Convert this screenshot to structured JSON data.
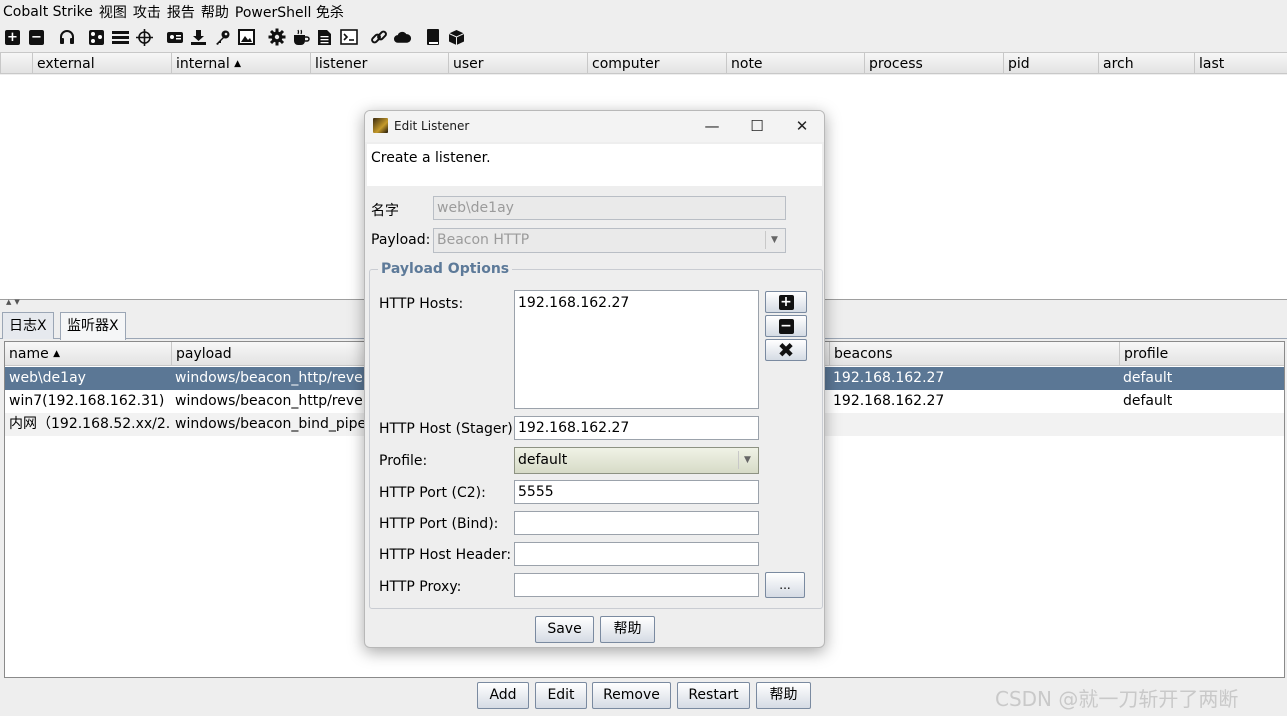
{
  "menubar": {
    "items": [
      "Cobalt Strike",
      "视图",
      "攻击",
      "报告",
      "帮助",
      "PowerShell 免杀"
    ]
  },
  "toolbar": {
    "icons": [
      "plus-box-icon",
      "minus-box-icon",
      "headphones-icon",
      "pivot-graph-icon",
      "session-table-icon",
      "targets-crosshair-icon",
      "credentials-icon",
      "downloads-icon",
      "key-icon",
      "screenshot-icon",
      "settings-gear-icon",
      "coffee-icon",
      "document-icon",
      "terminal-icon",
      "link-icon",
      "cloud-icon",
      "book-icon",
      "package-icon"
    ]
  },
  "beacon_table": {
    "columns": [
      "external",
      "internal",
      "listener",
      "user",
      "computer",
      "note",
      "process",
      "pid",
      "arch",
      "last"
    ],
    "sort_column": "internal"
  },
  "tabs": [
    "日志X",
    "监听器X"
  ],
  "listener_table": {
    "columns": [
      "name",
      "payload",
      "beacons",
      "profile"
    ],
    "rows": [
      {
        "name": "web\\de1ay",
        "payload": "windows/beacon_http/reverse_",
        "beacons": "192.168.162.27",
        "profile": "default"
      },
      {
        "name": "win7(192.168.162.31)",
        "payload": "windows/beacon_http/reverse_",
        "beacons": "192.168.162.27",
        "profile": "default"
      },
      {
        "name": "内网（192.168.52.xx/2...",
        "payload": "windows/beacon_bind_pipe",
        "beacons": "",
        "profile": ""
      }
    ]
  },
  "bottom_buttons": [
    "Add",
    "Edit",
    "Remove",
    "Restart",
    "帮助"
  ],
  "watermark": "CSDN @就一刀斩开了两断",
  "dialog": {
    "title": "Edit Listener",
    "window_controls": {
      "minimize": "—",
      "maximize": "☐",
      "close": "✕"
    },
    "description": "Create a listener.",
    "name_label": "名字",
    "name_value": "web\\de1ay",
    "payload_label": "Payload:",
    "payload_value": "Beacon HTTP",
    "options_title": "Payload Options",
    "hosts_label": "HTTP Hosts:",
    "hosts_value": "192.168.162.27",
    "stager_label": "HTTP Host (Stager):",
    "stager_value": "192.168.162.27",
    "profile_label": "Profile:",
    "profile_value": "default",
    "port_c2_label": "HTTP Port (C2):",
    "port_c2_value": "5555",
    "port_bind_label": "HTTP Port (Bind):",
    "port_bind_value": "",
    "host_header_label": "HTTP Host Header:",
    "host_header_value": "",
    "proxy_label": "HTTP Proxy:",
    "proxy_value": "",
    "proxy_button": "...",
    "save_label": "Save",
    "help_label": "帮助"
  }
}
